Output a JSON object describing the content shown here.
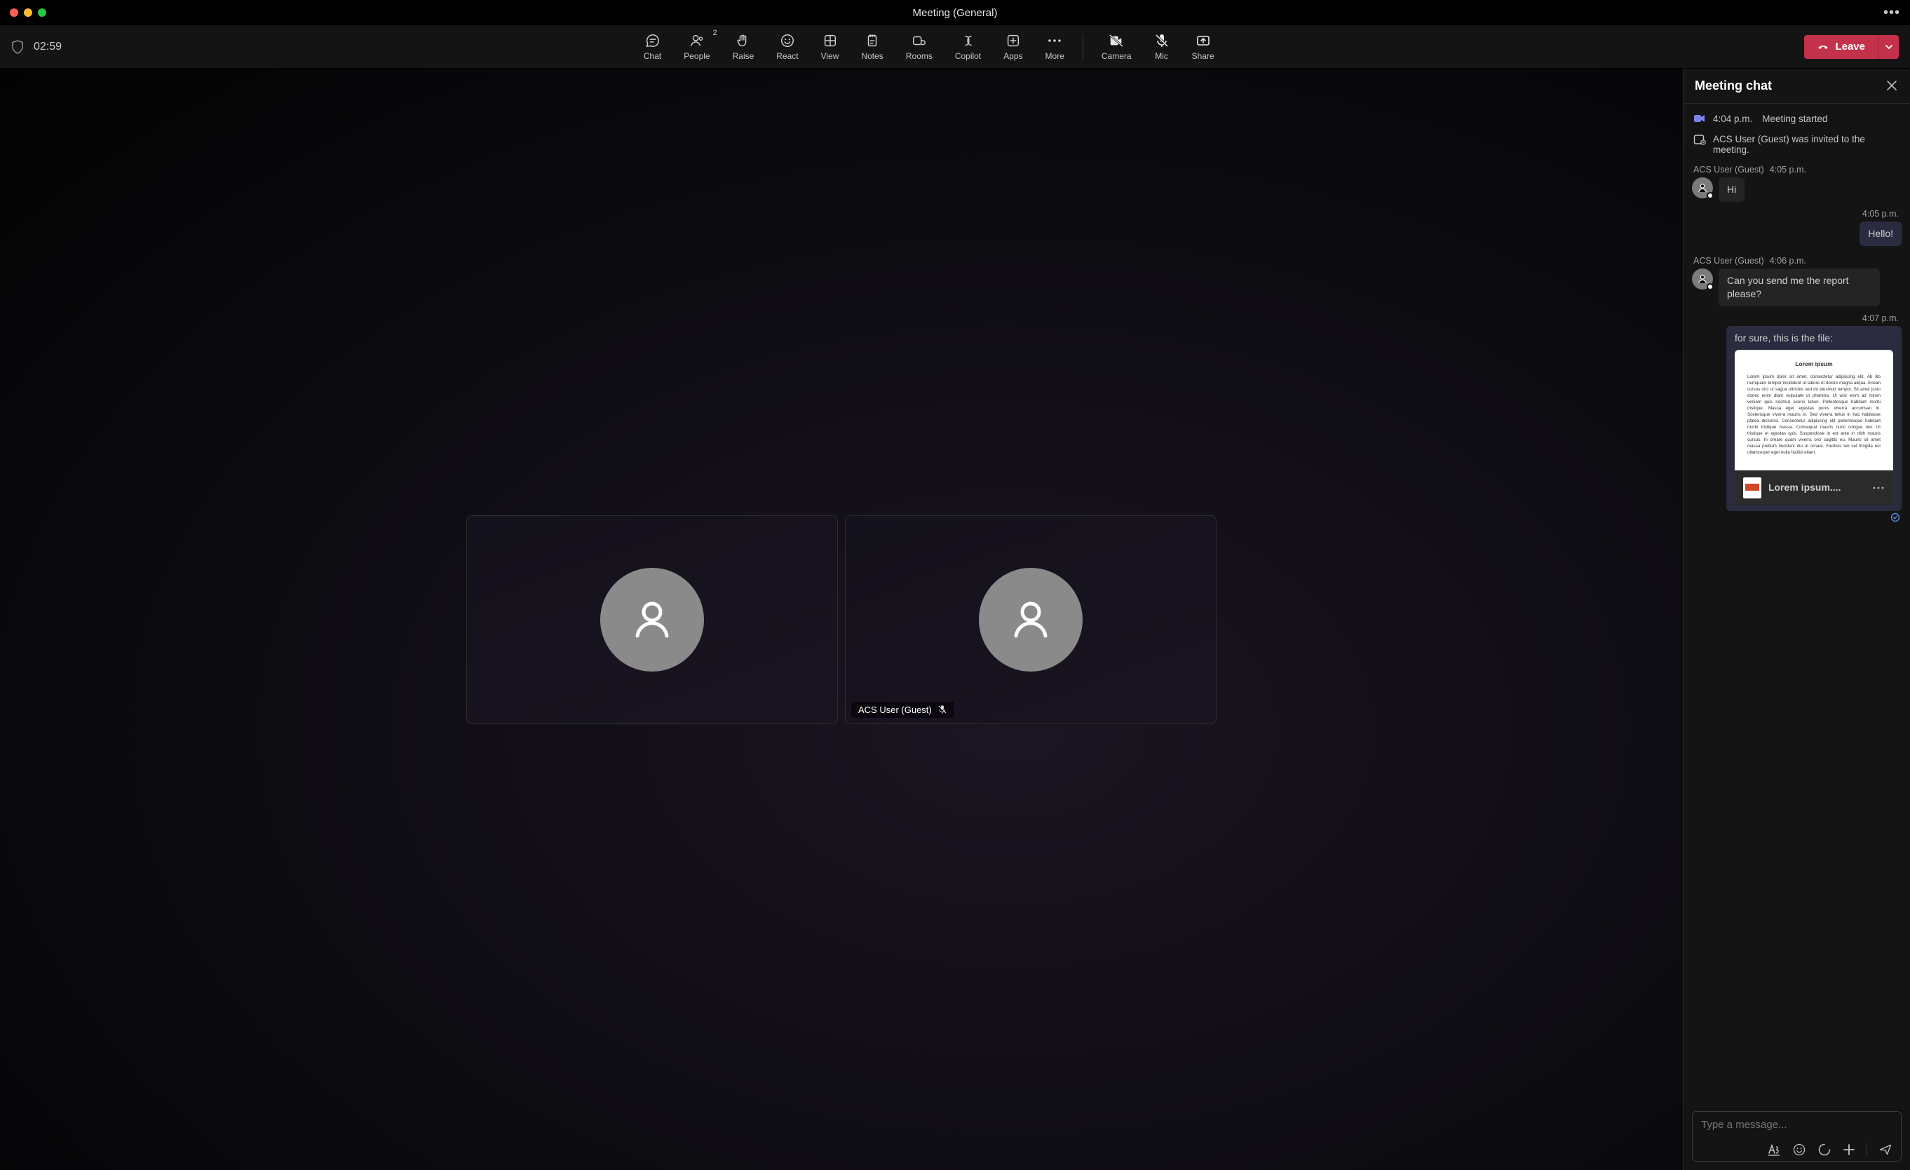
{
  "window": {
    "title": "Meeting (General)"
  },
  "timer": "02:59",
  "toolbar": {
    "chat": "Chat",
    "people": "People",
    "people_count": "2",
    "raise": "Raise",
    "react": "React",
    "view": "View",
    "notes": "Notes",
    "rooms": "Rooms",
    "copilot": "Copilot",
    "apps": "Apps",
    "more": "More",
    "camera": "Camera",
    "mic": "Mic",
    "share": "Share",
    "leave": "Leave"
  },
  "stage": {
    "participant2_name": "ACS User (Guest)"
  },
  "panel": {
    "title": "Meeting chat",
    "sys1_time": "4:04 p.m.",
    "sys1_text": "Meeting started",
    "sys2_text": "ACS User (Guest) was invited to the meeting.",
    "msg1_sender": "ACS User (Guest)",
    "msg1_time": "4:05 p.m.",
    "msg1_text": "Hi",
    "mine1_time": "4:05 p.m.",
    "mine1_text": "Hello!",
    "msg2_sender": "ACS User (Guest)",
    "msg2_time": "4:06 p.m.",
    "msg2_text": "Can you send me the report please?",
    "mine2_time": "4:07 p.m.",
    "mine2_text": "for sure, this is the file:",
    "file_preview_title": "Lorem ipsum",
    "file_preview_body": "Lorem ipsum dolor sit amet, consectetur adipiscing elit. Ab illo numquam tempor incididunt ut labore et dolore magna aliqua. Enean cursus orci ut sagua ultricies sed do eiusmod tempor. Sit amet justo donec enim diam vulputate ut pharetra. Ut wisi enim ad minim veniam quis nostrud exerci tation. Pellentesque habitant morbi tristique. Massa eget egestas purus viverra accumsan in. Scelerisque viverra mauris in. Sed viverra tellus in hac habitasse platea dictumst. Consectetur adipiscing elit pellentesque habitant morbi tristique massa. Consequat mauris nunc congue nisi. Ut tristique et egestas quis. Suspendisse in est ante in nibh mauris cursus. In ornare quam viverra orci sagittis eu. Mauris sit amet massa pretium tincidunt dui ut ornare. Facilisis leo vel fringilla est ullamcorper eget nulla facilisi etiam.",
    "file_name": "Lorem ipsum...."
  },
  "compose": {
    "placeholder": "Type a message..."
  }
}
